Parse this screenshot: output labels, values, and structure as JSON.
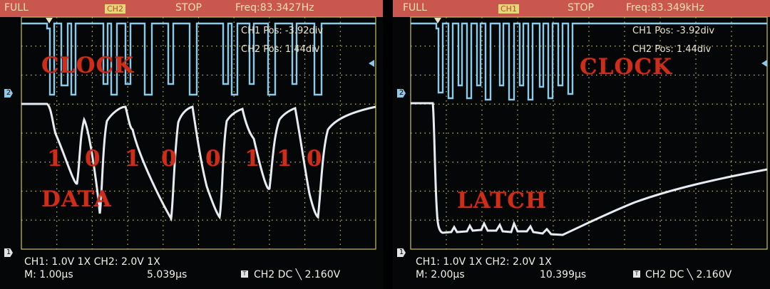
{
  "left": {
    "status": {
      "mode": "FULL",
      "channel": "CH2",
      "run_state": "STOP",
      "freq": "Freq:83.3427Hz"
    },
    "readout": {
      "ch1_pos": "CH1 Pos: -3.92div",
      "ch2_pos": "CH2 Pos: 1.44div"
    },
    "overlay": {
      "clock": "CLOCK",
      "data": "DATA",
      "bits": [
        "1",
        "0",
        "1",
        "0",
        "0",
        "1",
        "1",
        "0"
      ]
    },
    "bottom": {
      "line1": "CH1: 1.0V   1X   CH2: 2.0V   1X",
      "timebase": "M: 1.00µs",
      "delay": "5.039µs",
      "trigger": "CH2 DC ╲ 2.160V"
    },
    "markers": {
      "ch2": "2",
      "ch1": "1",
      "trig": "T"
    }
  },
  "right": {
    "status": {
      "mode": "FULL",
      "channel": "CH1",
      "run_state": "STOP",
      "freq": "Freq:83.349kHz"
    },
    "readout": {
      "ch1_pos": "CH1 Pos: -3.92div",
      "ch2_pos": "CH2 Pos: 1.44div"
    },
    "overlay": {
      "clock": "CLOCK",
      "latch": "LATCH"
    },
    "bottom": {
      "line1": "CH1: 1.0V   1X   CH2: 2.0V   1X",
      "timebase": "M: 2.00µs",
      "delay": "10.399µs",
      "trigger": "CH2 DC ╲ 2.160V"
    },
    "markers": {
      "ch2": "2",
      "ch1": "1",
      "trig": "T"
    }
  },
  "colors": {
    "status_bar": "#c9564f",
    "clock_trace": "#8ec9e8",
    "signal_trace": "#e6ecf2",
    "grid": "#c7c25a",
    "overlay_text": "#c8301e"
  }
}
